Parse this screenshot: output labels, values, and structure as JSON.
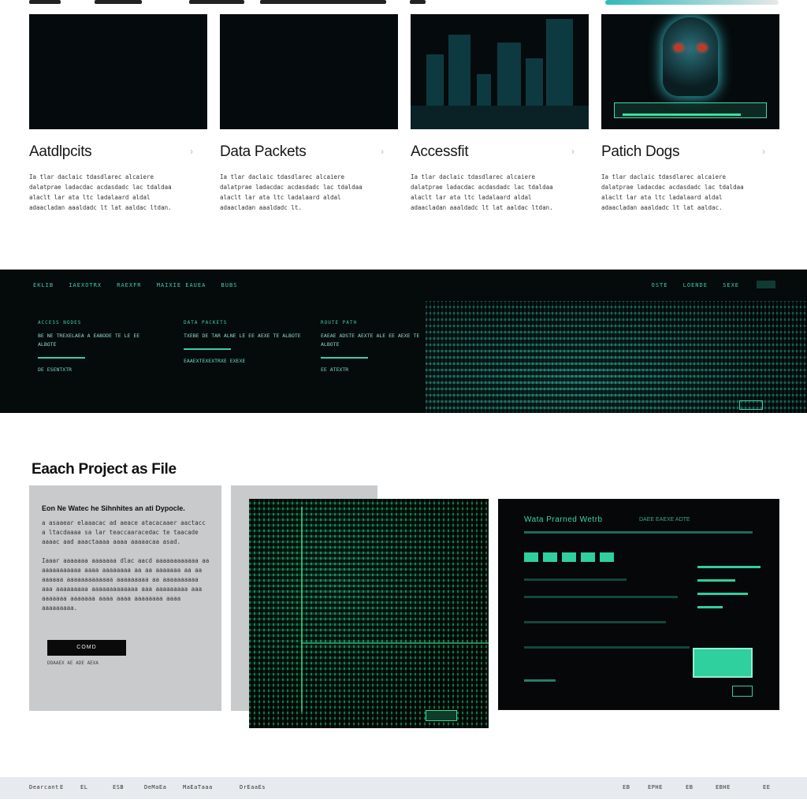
{
  "cards": [
    {
      "title": "Aatdlpcits",
      "desc": "Ia tlar daclaic tdasdlarec alcaiere dalatprae ladacdac acdasdadc lac tdaldaa alaclt lar ata ltc ladalaard aldal adaacladan aaaldadc lt lat aaldac ltdan.",
      "more": "›"
    },
    {
      "title": "Data Packets",
      "desc": "Ia tlar daclaic tdasdlarec alcaiere dalatprae ladacdac acdasdadc lac tdaldaa alaclt lar ata ltc ladalaard aldal adaacladan aaaldadc lt.",
      "more": "›"
    },
    {
      "title": "Accessfit",
      "desc": "Ia tlar daclaic tdasdlarec alcaiere dalatprae ladacdac acdasdadc lac tdaldaa alaclt lar ata ltc ladalaard aldal adaacladan aaaldadc lt lat aaldac ltdan.",
      "more": "›"
    },
    {
      "title": "Patich Dogs",
      "desc": "Ia tlar daclaic tdasdlarec alcaiere dalatprae ladacdac acdasdadc lac tdaldaa alaclt lar ata ltc ladalaard aldal adaacladan aaaldadc lt lat aaldac.",
      "more": "›"
    }
  ],
  "band": {
    "nav_left": [
      "EKLIB",
      "IAEXOTRX",
      "RAEXFR",
      "MAIXIE EAUEA",
      "BUBS"
    ],
    "nav_right": [
      "OSTE",
      "LOENDE",
      "SEXE"
    ],
    "columns": [
      {
        "key": "ACCESS NODES",
        "value": "BE NE TREXELAEA A EABODE TE LE EE ALBOTE",
        "link": "DE ESENTXTR"
      },
      {
        "key": "DATA PACKETS",
        "value": "TXEBE DE TAR ALNE LE EE AEXE TE ALBOTE",
        "link": "EAAEXTEXEXTRXE EXEXE"
      },
      {
        "key": "ROUTE PATH",
        "value": "EAEAE ADSTE AEXTE ALE EE AEXE TE ALBOTE",
        "link": "EE ATEXTR"
      }
    ]
  },
  "section2": {
    "heading": "Eaach Project as File",
    "panel_title": "Eon Ne Watec he Sihnhites an ati Dypocle.",
    "panel_p1": "a asaaear elaaacac ad aeace atacacaaer aactacc a ltacdaaaa sa lar teaccaaracedac te taacade aaaac aad aaactaaaa aaaa aaaaacaa asad.",
    "panel_p2": "Iaaar aaaaaaa aaaaaaa dlac aacd aaaaaaaaaaaa aa aaaaaaaaaaa aaaa aaaaaaaa aa aa aaaaaaa aa aa aaaaaa aaaaaaaaaaaaa aaaaaaaaa aa aaaaaaaaaa aaa aaaaaaaaa aaaaaaaaaaaaa aaa aaaaaaaaa aaa aaaaaaa aaaaaaa aaaa aaaa aaaaaaaa aaaa aaaaaaaaa.",
    "button_label": "COMD",
    "meta": "DDAAEX AE ADE AEXA",
    "dash_title": "Wata Prarned Wetrb",
    "dash_subtitle": "DAEE EAEXE ADTE"
  },
  "footer": {
    "left": [
      "Dearcant",
      "E",
      "EL",
      "ESB",
      "DeMaEa",
      "MaEaTaaa",
      "DrEaaEs"
    ],
    "right": [
      "EB",
      "EPHE",
      "EB",
      "EBHE",
      "EE"
    ]
  }
}
